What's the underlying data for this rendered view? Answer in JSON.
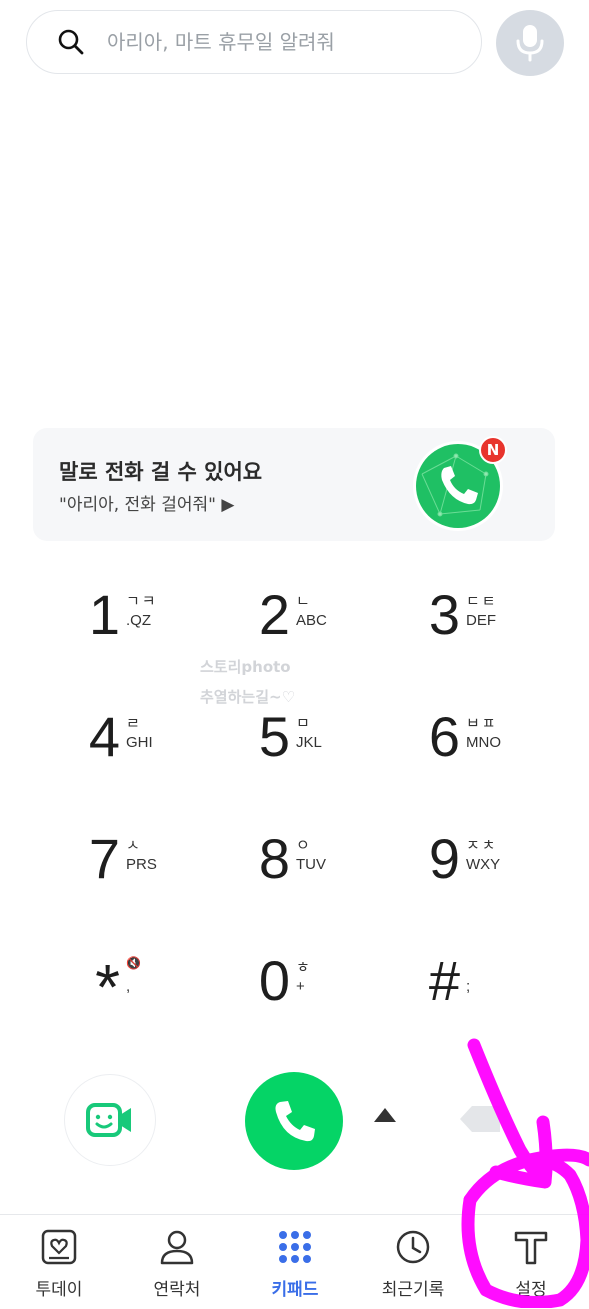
{
  "search": {
    "placeholder": "아리아, 마트 휴무일 알려줘",
    "icon": "search-icon"
  },
  "mic": {
    "icon": "microphone-icon"
  },
  "promo": {
    "title": "말로 전화 걸 수 있어요",
    "subtitle": "\"아리아, 전화 걸어줘\" ▶",
    "badge": "N",
    "icon": "phone-app-icon"
  },
  "watermark": {
    "line1": "스토리photo",
    "line2": "추열하는길~♡"
  },
  "keypad": [
    {
      "digit": "1",
      "kor": "ㄱㅋ",
      "eng": ".QZ"
    },
    {
      "digit": "2",
      "kor": "ㄴ",
      "eng": "ABC"
    },
    {
      "digit": "3",
      "kor": "ㄷㅌ",
      "eng": "DEF"
    },
    {
      "digit": "4",
      "kor": "ㄹ",
      "eng": "GHI"
    },
    {
      "digit": "5",
      "kor": "ㅁ",
      "eng": "JKL"
    },
    {
      "digit": "6",
      "kor": "ㅂㅍ",
      "eng": "MNO"
    },
    {
      "digit": "7",
      "kor": "ㅅ",
      "eng": "PRS"
    },
    {
      "digit": "8",
      "kor": "ㅇ",
      "eng": "TUV"
    },
    {
      "digit": "9",
      "kor": "ㅈㅊ",
      "eng": "WXY"
    },
    {
      "digit": "*",
      "kor": "🔇",
      "eng": ","
    },
    {
      "digit": "0",
      "kor": "ㅎ",
      "eng": "+"
    },
    {
      "digit": "#",
      "kor": "",
      "eng": ";"
    }
  ],
  "actions": {
    "video_icon": "video-call-icon",
    "call_icon": "phone-call-icon",
    "expand_icon": "triangle-up-icon",
    "backspace_icon": "backspace-icon"
  },
  "nav": {
    "items": [
      {
        "label": "투데이",
        "icon": "today-icon",
        "active": false
      },
      {
        "label": "연락처",
        "icon": "person-icon",
        "active": false
      },
      {
        "label": "키패드",
        "icon": "keypad-icon",
        "active": true
      },
      {
        "label": "최근기록",
        "icon": "clock-icon",
        "active": false
      },
      {
        "label": "설정",
        "icon": "settings-t-icon",
        "active": false
      }
    ]
  },
  "colors": {
    "accent": "#3a6ee8",
    "call_green": "#05d466",
    "video_green": "#18c97a",
    "annotation_magenta": "#ff00ff"
  }
}
